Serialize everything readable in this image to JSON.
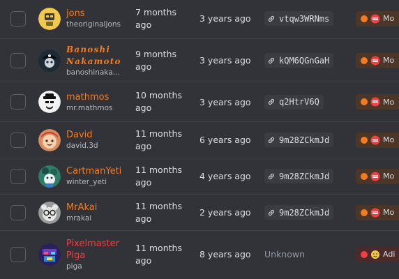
{
  "members": [
    {
      "display_name": "jons",
      "username": "theoriginaljons",
      "member_since": "7 months ago",
      "joined": "3 years ago",
      "invite": "vtqw3WRNms",
      "role": "Mo",
      "role_type": "mod",
      "avatar_icon": "yellow-robot-avatar"
    },
    {
      "display_name": "Banoshi Nakamoto",
      "username": "banoshinaka...",
      "member_since": "9 months ago",
      "joined": "3 years ago",
      "invite": "kQM6QGnGaH",
      "role": "Mo",
      "role_type": "mod",
      "avatar_icon": "pirate-avatar"
    },
    {
      "display_name": "mathmos",
      "username": "mr.mathmos",
      "member_since": "10 months ago",
      "joined": "3 years ago",
      "invite": "q2HtrV6Q",
      "role": "Mo",
      "role_type": "mod",
      "avatar_icon": "heisenberg-avatar"
    },
    {
      "display_name": "David",
      "username": "david.3d",
      "member_since": "11 months ago",
      "joined": "6 years ago",
      "invite": "9m28ZCkmJd",
      "role": "Mo",
      "role_type": "mod",
      "avatar_icon": "cartoon-face-avatar"
    },
    {
      "display_name": "CartmanYeti",
      "username": "winter_yeti",
      "member_since": "11 months ago",
      "joined": "4 years ago",
      "invite": "9m28ZCkmJd",
      "role": "Mo",
      "role_type": "mod",
      "avatar_icon": "yeti-avatar"
    },
    {
      "display_name": "MrAkai",
      "username": "mrakai",
      "member_since": "11 months ago",
      "joined": "2 years ago",
      "invite": "9m28ZCkmJd",
      "role": "Mo",
      "role_type": "mod",
      "avatar_icon": "glasses-bear-avatar"
    },
    {
      "display_name": "Pixelmaster Piga",
      "username": "piga",
      "member_since": "11 months ago",
      "joined": "8 years ago",
      "invite": "Unknown",
      "role": "Adi",
      "role_type": "admin",
      "avatar_icon": "pixel-avatar"
    }
  ],
  "colors": {
    "background": "#313338",
    "mod_accent": "#f47b20",
    "admin_accent": "#f23f43"
  }
}
